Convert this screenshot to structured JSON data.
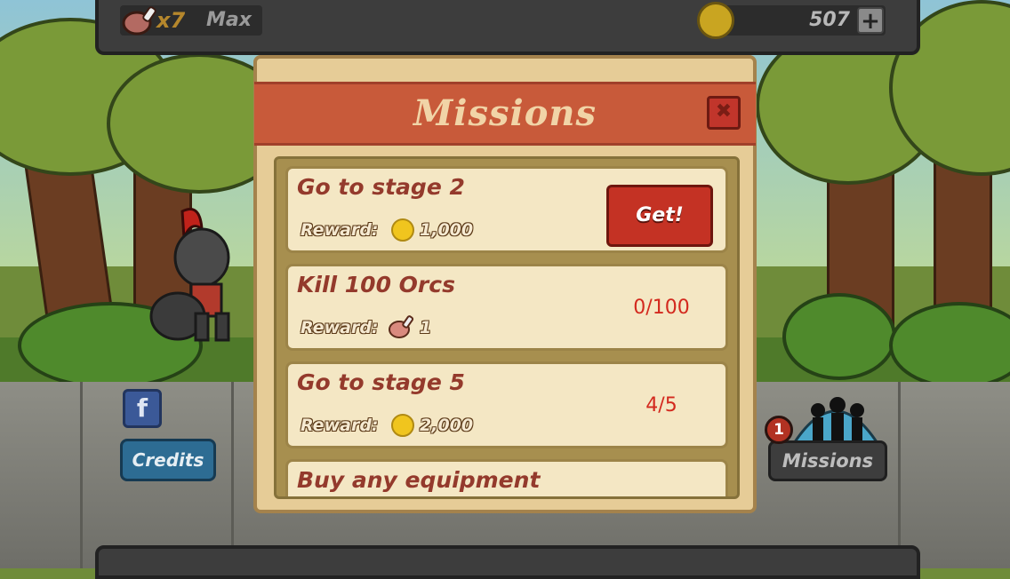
{
  "hud": {
    "meat_count": "x7",
    "max_label": "Max",
    "gold_amount": "507",
    "add_gold_label": "+"
  },
  "buttons": {
    "facebook_label": "f",
    "credits_label": "Credits",
    "missions_label": "Missions",
    "missions_badge": "1"
  },
  "dialog": {
    "title": "Missions",
    "close_label": "✖",
    "missions": [
      {
        "title": "Go to stage 2",
        "reward_label": "Reward:",
        "reward_icon": "gold-coin-icon",
        "reward_value": "1,000",
        "action_label": "Get!"
      },
      {
        "title": "Kill 100 Orcs",
        "reward_label": "Reward:",
        "reward_icon": "meat-icon",
        "reward_value": "1",
        "progress": "0/100"
      },
      {
        "title": "Go to stage 5",
        "reward_label": "Reward:",
        "reward_icon": "gold-coin-icon",
        "reward_value": "2,000",
        "progress": "4/5"
      },
      {
        "title": "Buy any equipment"
      }
    ]
  },
  "colors": {
    "dialog_bg": "#e6cc97",
    "title_band": "#c85a3a",
    "get_button": "#c43224",
    "progress_text": "#d3291e"
  }
}
